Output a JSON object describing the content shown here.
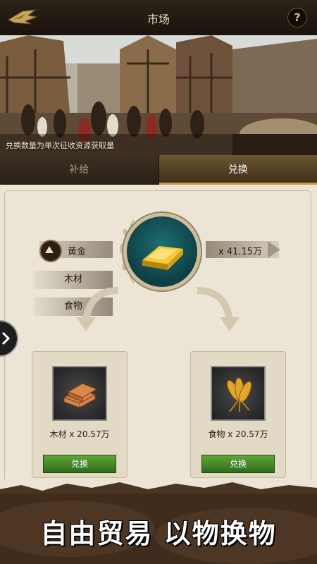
{
  "header": {
    "title": "市场",
    "help_label": "?"
  },
  "banner": {
    "caption": "兑换数量为单次征收资源获取量"
  },
  "tabs": [
    {
      "label": "补给",
      "active": false
    },
    {
      "label": "兑换",
      "active": true
    }
  ],
  "exchange": {
    "source": {
      "label": "黄金",
      "amount": "x 41.15万",
      "icon": "gold-bar-icon"
    },
    "options": [
      {
        "label": "木材"
      },
      {
        "label": "食物"
      }
    ],
    "targets": [
      {
        "label": "木材 x 20.57万",
        "button": "兑换",
        "icon": "wood-planks-icon"
      },
      {
        "label": "食物 x 20.57万",
        "button": "兑换",
        "icon": "wheat-icon"
      }
    ]
  },
  "footer": {
    "slogan": "自由贸易 以物换物"
  },
  "colors": {
    "accent": "#c89b4a",
    "button_green": "#3f8a25",
    "panel_bg": "#ece5d5",
    "teal": "#1d6e72"
  }
}
